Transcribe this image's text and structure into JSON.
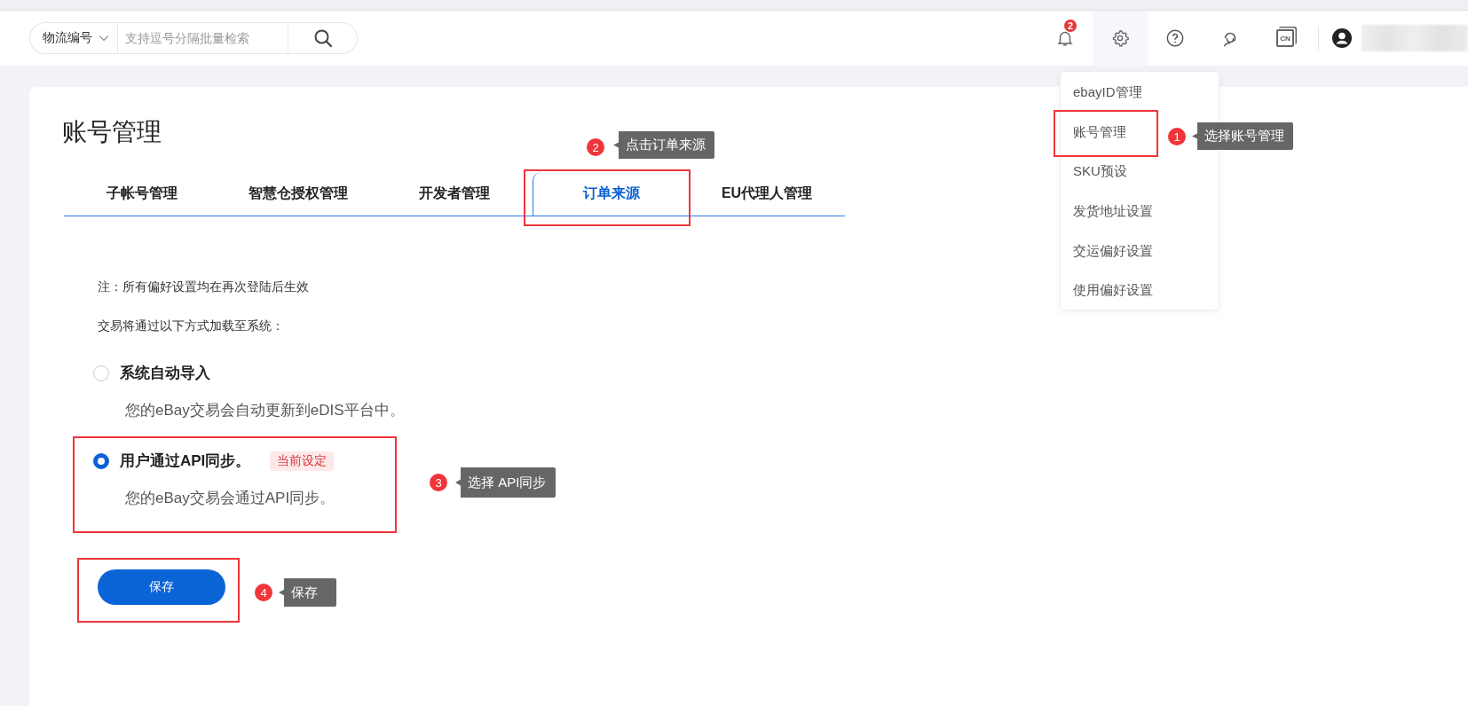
{
  "search": {
    "field_type": "物流编号",
    "placeholder": "支持逗号分隔批量检索"
  },
  "header": {
    "notification_count": "2",
    "language": "CN"
  },
  "settings_menu": {
    "items": [
      {
        "label": "ebayID管理"
      },
      {
        "label": "账号管理"
      },
      {
        "label": "SKU预设"
      },
      {
        "label": "发货地址设置"
      },
      {
        "label": "交运偏好设置"
      },
      {
        "label": "使用偏好设置"
      }
    ]
  },
  "page_title": "账号管理",
  "tabs": [
    {
      "label": "子帐号管理",
      "selected": false
    },
    {
      "label": "智慧仓授权管理",
      "selected": false
    },
    {
      "label": "开发者管理",
      "selected": false
    },
    {
      "label": "订单来源",
      "selected": true
    },
    {
      "label": "EU代理人管理",
      "selected": false
    }
  ],
  "note": "注：所有偏好设置均在再次登陆后生效",
  "intro": "交易将通过以下方式加载至系统：",
  "options": [
    {
      "label": "系统自动导入",
      "description": "您的eBay交易会自动更新到eDIS平台中。",
      "selected": false
    },
    {
      "label": "用户通过API同步。",
      "badge": "当前设定",
      "description": "您的eBay交易会通过API同步。",
      "selected": true
    }
  ],
  "save_button": "保存",
  "annotations": [
    {
      "kind": "menu",
      "number": "1",
      "text": "选择账号管理"
    },
    {
      "kind": "tab",
      "number": "2",
      "text": "点击订单来源"
    },
    {
      "kind": "option",
      "number": "3",
      "text": "选择 API同步"
    },
    {
      "kind": "save",
      "number": "4",
      "text": "保存"
    }
  ]
}
